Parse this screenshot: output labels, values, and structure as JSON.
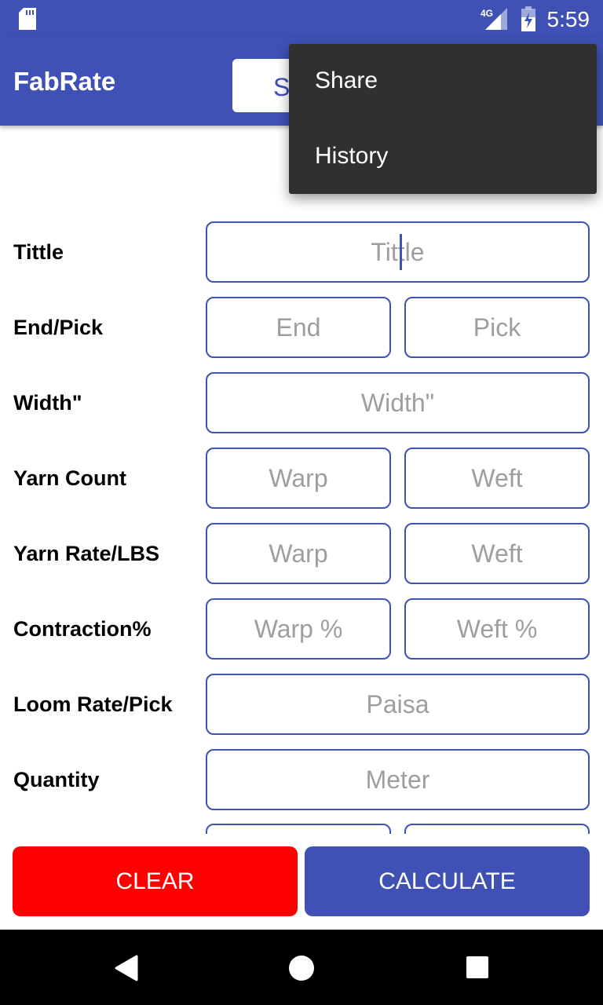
{
  "status_bar": {
    "time": "5:59",
    "network": "4G",
    "icons": [
      "sd-card-icon",
      "signal-icon",
      "battery-charging-icon"
    ]
  },
  "app_bar": {
    "title": "FabRate",
    "button_label": "S"
  },
  "overflow_menu": {
    "items": [
      "Share",
      "History"
    ]
  },
  "form": {
    "rows": [
      {
        "label": "Tittle",
        "fields": [
          "Tittle"
        ]
      },
      {
        "label": "End/Pick",
        "fields": [
          "End",
          "Pick"
        ]
      },
      {
        "label": "Width\"",
        "fields": [
          "Width\""
        ]
      },
      {
        "label": "Yarn Count",
        "fields": [
          "Warp",
          "Weft"
        ]
      },
      {
        "label": "Yarn Rate/LBS",
        "fields": [
          "Warp",
          "Weft"
        ]
      },
      {
        "label": "Contraction%",
        "fields": [
          "Warp %",
          "Weft %"
        ]
      },
      {
        "label": "Loom Rate/Pick",
        "fields": [
          "Paisa"
        ]
      },
      {
        "label": "Quantity",
        "fields": [
          "Meter"
        ]
      }
    ]
  },
  "actions": {
    "clear": "CLEAR",
    "calculate": "CALCULATE"
  },
  "colors": {
    "primary": "#3f51b5",
    "clear": "#ff0000",
    "menu": "#303030"
  }
}
